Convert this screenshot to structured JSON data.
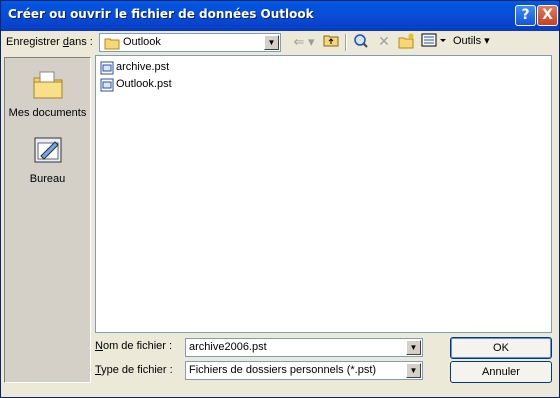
{
  "window": {
    "title": "Créer ou ouvrir le fichier de données Outlook",
    "help": "?",
    "close": "X"
  },
  "lookin": {
    "label_pre": "Enregistrer ",
    "label_ul": "d",
    "label_post": "ans :",
    "value": "Outlook"
  },
  "toolbar": {
    "tools_label": "Outils ▾"
  },
  "places": [
    {
      "label": "Mes documents",
      "icon": "my-documents-icon"
    },
    {
      "label": "Bureau",
      "icon": "desktop-icon"
    }
  ],
  "files": [
    {
      "name": "archive.pst",
      "icon": "pst-file-icon"
    },
    {
      "name": "Outlook.pst",
      "icon": "pst-file-icon"
    }
  ],
  "filename": {
    "label_ul": "N",
    "label_post": "om de fichier :",
    "value": "archive2006.pst"
  },
  "filetype": {
    "label_ul": "T",
    "label_post": "ype de fichier :",
    "value": "Fichiers de dossiers personnels (*.pst)"
  },
  "buttons": {
    "ok": "OK",
    "cancel": "Annuler"
  },
  "colors": {
    "titlebar": "#0a4cd6",
    "background": "#ece9d8",
    "border_accent": "#7f9db9"
  }
}
